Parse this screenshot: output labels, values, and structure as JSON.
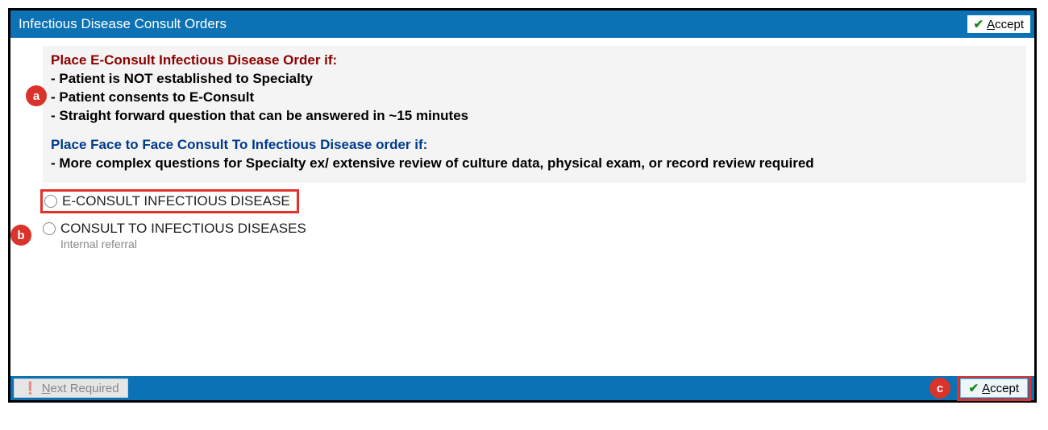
{
  "titlebar": {
    "title": "Infectious Disease Consult Orders",
    "accept_label": "Accept"
  },
  "instructions": {
    "heading_econsult": "Place E-Consult Infectious Disease Order if:",
    "econsult_bullets": [
      "- Patient is NOT established to Specialty",
      "- Patient consents to E-Consult",
      "- Straight forward question that can be answered in ~15 minutes"
    ],
    "heading_f2f": "Place Face to Face Consult To Infectious Disease order if:",
    "f2f_bullets": [
      "- More complex questions for Specialty ex/ extensive review of culture data, physical exam, or record review required"
    ]
  },
  "options": {
    "opt1": "E-CONSULT INFECTIOUS DISEASE",
    "opt2": "CONSULT TO INFECTIOUS DISEASES",
    "opt2_sub": "Internal referral"
  },
  "footer": {
    "next_required": "Next Required",
    "accept_label": "Accept"
  },
  "callouts": {
    "a": "a",
    "b": "b",
    "c": "c"
  }
}
